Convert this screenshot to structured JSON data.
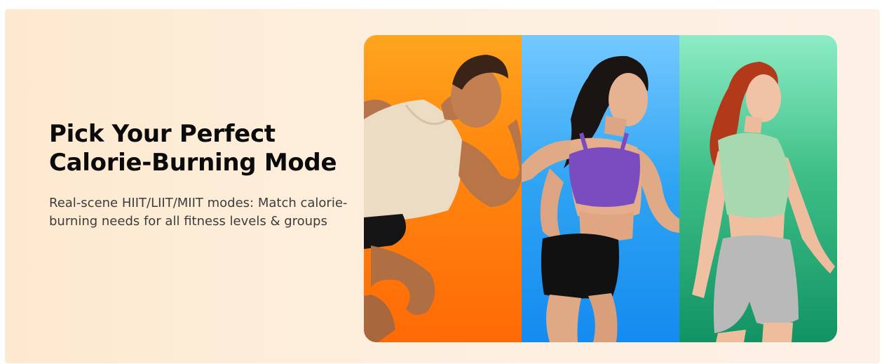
{
  "banner": {
    "headline_line1": "Pick Your Perfect",
    "headline_line2": "Calorie-Burning Mode",
    "description": "Real-scene HIIT/LIIT/MIIT modes: Match calorie-burning needs for all fitness levels & groups"
  },
  "panels": [
    {
      "name": "runner-man",
      "background": "#ff7a0a",
      "figure": "sprinting man in cream tank top"
    },
    {
      "name": "runner-woman",
      "background": "#2ea3f3",
      "figure": "running woman in purple sports bra"
    },
    {
      "name": "walker-woman",
      "background": "#2faf78",
      "figure": "walking woman in mint t-shirt"
    }
  ],
  "colors": {
    "banner_bg": "#fdeede",
    "headline": "#0b0b0b",
    "description": "#3c3c3c"
  }
}
